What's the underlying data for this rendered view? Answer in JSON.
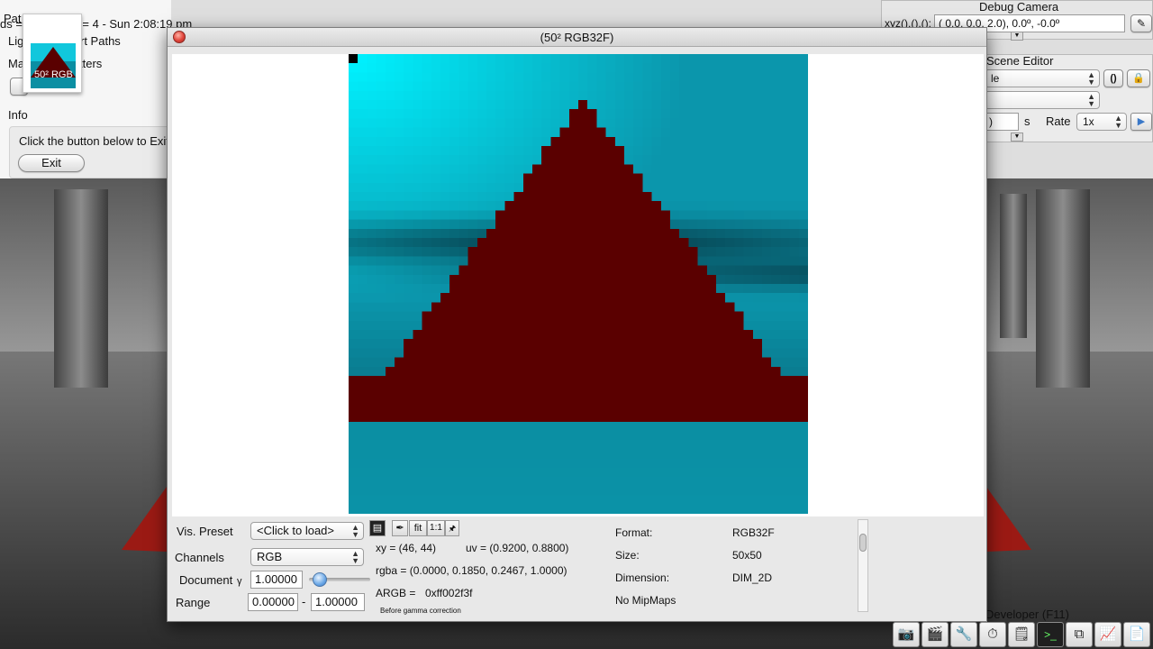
{
  "background_scene": {
    "description_colors": {
      "floor": "#3b3b3b",
      "wall": "#8a8a8a",
      "red": "#9b1a14"
    }
  },
  "top_left": {
    "status_text": "ds = Numcores = 4 - Sun 2:08:19 pm",
    "path_label_partial": "Pat",
    "lights_label_partial": "Lig",
    "paths_label_partial": "rt Paths",
    "ma_label_partial": "Ma",
    "tters_label_partial": "tters",
    "info_label": "Info",
    "info_text": "Click the button below to Exit",
    "exit_label": "Exit",
    "thumbnail_caption": "50² RGB"
  },
  "debug_camera": {
    "title": "Debug Camera",
    "xyz_label": "xyz(),(),():",
    "xyz_value": "( 0.0,  0.0,  2.0),  0.0º,  -0.0º"
  },
  "scene_editor": {
    "title": "Scene Editor",
    "dropdown1_value": "le",
    "dropdown2_value": "",
    "time_value": ")",
    "time_unit": "s",
    "rate_label": "Rate",
    "rate_value": "1x",
    "braces_label": "()"
  },
  "texture_window": {
    "title": "(50² RGB32F)",
    "vis_preset_label": "Vis. Preset",
    "vis_preset_value": "<Click to load>",
    "channels_label": "Channels",
    "channels_value": "RGB",
    "document_label": "Document",
    "gamma_symbol": "γ",
    "gamma_value": "1.00000",
    "range_label": "Range",
    "range_min": "0.00000",
    "range_sep": "-",
    "range_max": "1.00000",
    "fit_label": "fit",
    "one_to_one_label": "1:1",
    "xy_text": "xy =  (46, 44)",
    "uv_text": "uv =  (0.9200, 0.8800)",
    "rgba_text": "rgba =  (0.0000, 0.1850, 0.2467, 1.0000)",
    "argb_label": "ARGB =",
    "argb_value": "0xff002f3f",
    "gamma_note": "Before gamma correction",
    "format_label": "Format:",
    "format_value": "RGB32F",
    "size_label": "Size:",
    "size_value": "50x50",
    "dimension_label": "Dimension:",
    "dimension_value": "DIM_2D",
    "mipmaps_text": "No MipMaps",
    "gamma_slider_fraction": 0.18
  },
  "developer_label": "Developer (F11)",
  "dock_icons": [
    "camera-icon",
    "film-clapper-icon",
    "tools-icon",
    "clock-icon",
    "notepad-icon",
    "terminal-icon",
    "windows-icon",
    "monitor-graph-icon",
    "document-icon"
  ],
  "texture_colors": {
    "cyan_bright": "#00f2ff",
    "cyan": "#0b96ac",
    "teal_dark": "#063946",
    "red": "#5a0000",
    "floor": "#0b8fa3",
    "marker": "#000000"
  }
}
